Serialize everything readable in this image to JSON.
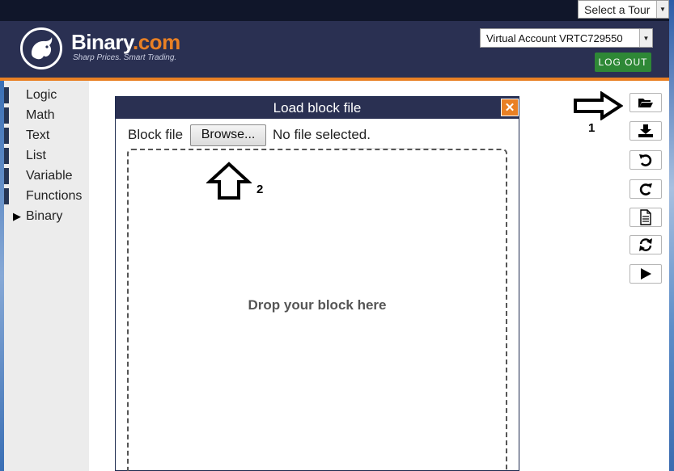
{
  "tour": {
    "label": "Select a Tour"
  },
  "brand": {
    "name": "Binary",
    "suffix": ".com",
    "tagline": "Sharp Prices. Smart Trading."
  },
  "account": {
    "selected": "Virtual Account VRTC729550",
    "logout_label": "LOG OUT"
  },
  "toolbox": {
    "categories": [
      {
        "label": "Logic"
      },
      {
        "label": "Math"
      },
      {
        "label": "Text"
      },
      {
        "label": "List"
      },
      {
        "label": "Variable"
      },
      {
        "label": "Functions"
      },
      {
        "label": "Binary",
        "expandable": true
      }
    ]
  },
  "dialog": {
    "title": "Load block file",
    "close_icon": "close-icon",
    "file_label": "Block file",
    "browse_label": "Browse...",
    "file_status": "No file selected.",
    "drop_text": "Drop your block here"
  },
  "annotations": {
    "arrow1_label": "1",
    "arrow2_label": "2"
  },
  "toolbar": {
    "buttons": [
      {
        "icon": "folder-open-icon"
      },
      {
        "icon": "download-icon"
      },
      {
        "icon": "undo-icon"
      },
      {
        "icon": "redo-icon"
      },
      {
        "icon": "document-icon"
      },
      {
        "icon": "refresh-icon"
      },
      {
        "icon": "play-icon"
      }
    ]
  },
  "colors": {
    "header": "#2a3052",
    "accent": "#e98024",
    "logout": "#2e8836",
    "topbar": "#10162a"
  }
}
